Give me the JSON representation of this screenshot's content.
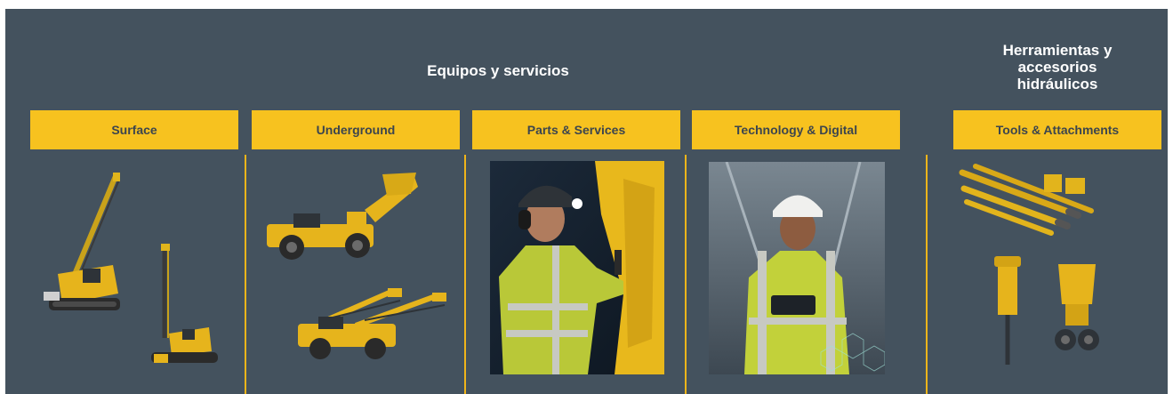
{
  "headings": {
    "main": "Equipos y servicios",
    "tools_line1": "Herramientas y",
    "tools_line2": "accesorios",
    "tools_line3": "hidráulicos"
  },
  "categories": [
    {
      "label": "Surface"
    },
    {
      "label": "Underground"
    },
    {
      "label": "Parts & Services"
    },
    {
      "label": "Technology & Digital"
    },
    {
      "label": "Tools & Attachments"
    }
  ],
  "colors": {
    "panel": "#44525e",
    "accent": "#f7c21f",
    "button_text": "#3c454e",
    "divider": "#f0b51a"
  },
  "images": [
    {
      "name": "surface-drill-rigs-image"
    },
    {
      "name": "underground-loader-and-drill-image"
    },
    {
      "name": "parts-services-technician-photo"
    },
    {
      "name": "technology-digital-worker-tablet-photo"
    },
    {
      "name": "tools-attachments-image"
    }
  ]
}
